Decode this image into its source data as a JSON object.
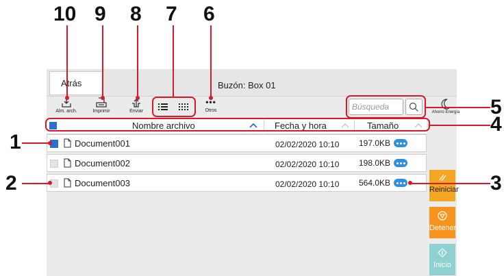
{
  "callouts": [
    "10",
    "9",
    "8",
    "7",
    "6",
    "5",
    "4",
    "3",
    "2",
    "1"
  ],
  "header": {
    "back_label": "Atrás",
    "box_title": "Buzón: Box 01"
  },
  "toolbar": {
    "store_label": "Alm. arch.",
    "print_label": "Imprimir",
    "send_label": "Enviar",
    "others_label": "Otros",
    "others_glyph": "•••"
  },
  "search": {
    "placeholder": "Búsqueda"
  },
  "energy": {
    "label": "Ahorro Energía"
  },
  "table": {
    "columns": [
      "Nombre archivo",
      "Fecha y hora",
      "Tamaño"
    ],
    "rows": [
      {
        "checked": true,
        "name": "Document001",
        "date": "02/02/2020 10:10",
        "size": "197.0KB"
      },
      {
        "checked": false,
        "name": "Document002",
        "date": "02/02/2020 10:10",
        "size": "198.0KB"
      },
      {
        "checked": false,
        "name": "Document003",
        "date": "02/02/2020 10:10",
        "size": "564.0KB"
      }
    ]
  },
  "side_buttons": {
    "reset_label": "Reiniciar",
    "stop_label": "Detener",
    "start_label": "Inicio"
  },
  "colors": {
    "accent_red": "#d8192b",
    "reset_orange": "#f5a623",
    "stop_orange": "#f7941d",
    "start_teal": "#8fd1d1",
    "link_blue": "#2b6fd6"
  }
}
